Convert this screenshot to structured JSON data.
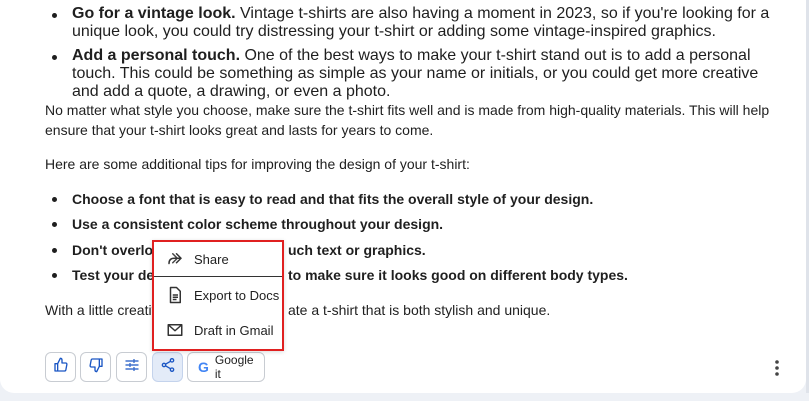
{
  "content": {
    "bullet_top_1_bold": "Go for a vintage look.",
    "bullet_top_1_text": " Vintage t-shirts are also having a moment in 2023, so if you're looking for a unique look, you could try distressing your t-shirt or adding some vintage-inspired graphics.",
    "bullet_top_2_bold": "Add a personal touch.",
    "bullet_top_2_text": " One of the best ways to make your t-shirt stand out is to add a personal touch. This could be something as simple as your name or initials, or you could get more creative and add a quote, a drawing, or even a photo.",
    "paragraph_1": "No matter what style you choose, make sure the t-shirt fits well and is made from high-quality materials. This will help ensure that your t-shirt looks great and lasts for years to come.",
    "paragraph_2": "Here are some additional tips for improving the design of your t-shirt:",
    "tips": [
      "Choose a font that is easy to read and that fits the overall style of your design.",
      "Use a consistent color scheme throughout your design.",
      "Don't overload",
      "Test your desig"
    ],
    "tips_tail": [
      "",
      "",
      "uch text or graphics.",
      "to make sure it looks good on different body types."
    ],
    "closing_head": "With a little creativit",
    "closing_tail": "ate a t-shirt that is both stylish and unique."
  },
  "share_menu": {
    "items": [
      {
        "label": "Share",
        "icon": "share-arrow-icon"
      },
      {
        "label": "Export to Docs",
        "icon": "docs-icon"
      },
      {
        "label": "Draft in Gmail",
        "icon": "gmail-icon"
      }
    ],
    "highlight_color": "#e02020"
  },
  "action_bar": {
    "google_label": "Google it",
    "icons": [
      "thumbs-up-icon",
      "thumbs-down-icon",
      "tune-icon",
      "share-icon",
      "google-icon",
      "more-vert-icon"
    ]
  }
}
